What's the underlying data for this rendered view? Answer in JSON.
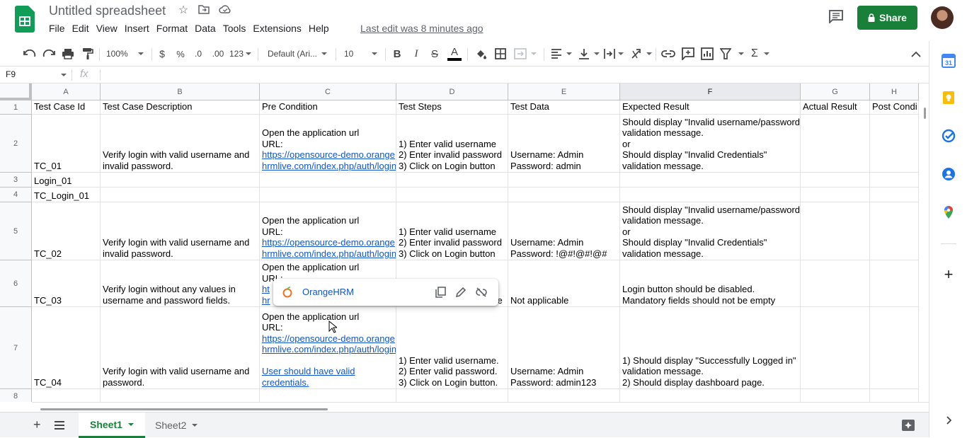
{
  "app": {
    "title": "Untitled spreadsheet",
    "last_edit": "Last edit was 8 minutes ago",
    "share_label": "Share",
    "accent": "#188038"
  },
  "menu": [
    "File",
    "Edit",
    "View",
    "Insert",
    "Format",
    "Data",
    "Tools",
    "Extensions",
    "Help"
  ],
  "toolbar": {
    "zoom": "100%",
    "currency": "$",
    "percent": "%",
    "dec_decrease": ".0",
    "dec_increase": ".00",
    "more_formats": "123",
    "font": "Default (Ari...",
    "font_size": "10",
    "bold": "B",
    "italic": "I",
    "strike": "S",
    "text_color": "A",
    "functions": "Σ"
  },
  "formula_bar": {
    "cell_ref": "F9",
    "fx": "fx",
    "value": ""
  },
  "columns": [
    "A",
    "B",
    "C",
    "D",
    "E",
    "F",
    "G",
    "H"
  ],
  "selected_column": "F",
  "rows": [
    {
      "num": "1",
      "cells": [
        "Test Case Id",
        "Test Case Description",
        "Pre Condition",
        "Test Steps",
        "Test Data",
        "Expected Result",
        "Actual Result",
        "Post Condi"
      ]
    },
    {
      "num": "2",
      "cells": [
        "TC_01",
        "Verify login with valid username and\ninvalid password.",
        "Open the application url\nURL:\n[https://opensource-demo.orange\nhrmlive.com/index.php/auth/login]",
        "1) Enter valid username\n2) Enter invalid password\n3) Click on Login button",
        "Username: Admin\nPassword: admin",
        "Should display \"Invalid username/password\"\nvalidation message.\nor\nShould display \"Invalid Credentials\"\nvalidation message.",
        "",
        ""
      ]
    },
    {
      "num": "3",
      "cells": [
        "Login_01",
        "",
        "",
        "",
        "",
        "",
        "",
        ""
      ]
    },
    {
      "num": "4",
      "cells": [
        "TC_Login_01",
        "",
        "",
        "",
        "",
        "",
        "",
        ""
      ]
    },
    {
      "num": "5",
      "cells": [
        "TC_02",
        "Verify login with valid username and\ninvalid password.",
        "Open the application url\nURL:\n[https://opensource-demo.orange\nhrmlive.com/index.php/auth/login]",
        "1) Enter valid username\n2) Enter invalid password\n3) Click on Login button",
        "Username: Admin\nPassword: !@#!@#!@#",
        "Should display \"Invalid username/password\"\nvalidation message.\nor\nShould display \"Invalid Credentials\"\nvalidation message.",
        "",
        ""
      ]
    },
    {
      "num": "6",
      "cells": [
        "TC_03",
        "Verify login without any values in\nusername and password fields.",
        "Open the application url\nURL:\n[ht]\n[hr]",
        "1) Leave blank username",
        "Not applicable",
        "Login button should be disabled.\nMandatory fields should not be empty",
        "",
        ""
      ]
    },
    {
      "num": "7",
      "cells": [
        "TC_04",
        "Verify login with valid username and\npassword.",
        "Open the application url\nURL:\n[https://opensource-demo.orange\nhrmlive.com/index.php/auth/login]\n\n[User should have valid\ncredentials.]",
        "1) Enter valid username.\n2) Enter valid password.\n3) Click on Login button.",
        "Username: Admin\nPassword: admin123",
        "1) Should display \"Successfully Logged in\"\nvalidation message.\n2) Should display dashboard page.",
        "",
        ""
      ]
    },
    {
      "num": "8",
      "cells": [
        "",
        "",
        "",
        "",
        "",
        "",
        "",
        ""
      ]
    }
  ],
  "link_popup": {
    "title": "OrangeHRM"
  },
  "sheets": [
    {
      "name": "Sheet1",
      "active": true
    },
    {
      "name": "Sheet2",
      "active": false
    }
  ],
  "side_icons": [
    "calendar-icon",
    "keep-icon",
    "tasks-icon",
    "contacts-icon",
    "maps-icon",
    "add-icon"
  ]
}
